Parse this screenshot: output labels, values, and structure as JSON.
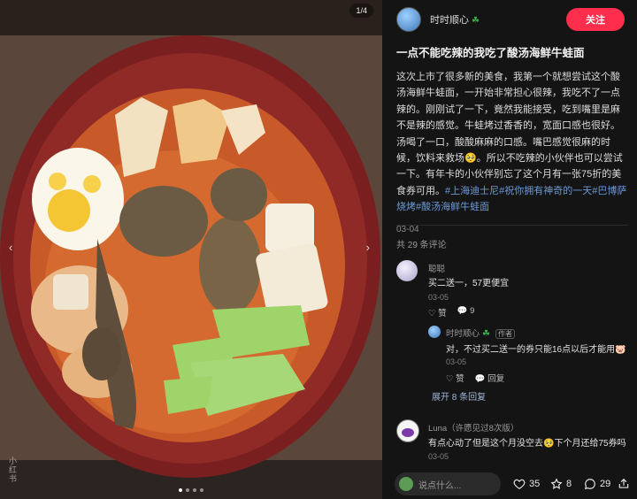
{
  "media": {
    "counter": "1/4",
    "watermark": "小红书",
    "nav_left": "‹",
    "nav_right": "›",
    "dots": [
      true,
      false,
      false,
      false
    ]
  },
  "author": {
    "name": "时时顺心",
    "badge": "☘",
    "follow_label": "关注"
  },
  "post": {
    "title": "一点不能吃辣的我吃了酸汤海鲜牛蛙面",
    "body": "这次上市了很多新的美食，我第一个就想尝试这个酸汤海鲜牛蛙面，一开始非常担心很辣，我吃不了一点辣的。刚刚试了一下，竟然我能接受，吃到嘴里是麻不是辣的感觉。牛蛙烤过香香的，宽面口感也很好。汤喝了一口，酸酸麻麻的口感。嘴巴感觉很麻的时候，饮料来救场🥺。所以不吃辣的小伙伴也可以尝试一下。有年卡的小伙伴别忘了这个月有一张75折的美食券可用。",
    "tags": [
      "#上海迪士尼",
      "#祝你拥有神奇的一天",
      "#巴博萨烧烤",
      "#酸汤海鲜牛蛙面"
    ],
    "date": "03-04"
  },
  "comments_header": "共 29 条评论",
  "comments": [
    {
      "name": "聪聪",
      "text": "买二送一，57更便宜",
      "date": "03-05",
      "like_label": "赞",
      "reply_count": "9"
    },
    {
      "name": "时时顺心",
      "badge": "☘",
      "author_tag": "作者",
      "text": "对，不过买二送一的券只能16点以后才能用🐷",
      "date": "03-05",
      "like_label": "赞",
      "reply_label": "回复",
      "expand_label": "展开 8 条回复"
    },
    {
      "name": "Luna（许愿见过8次版）",
      "text": "有点心动了但是这个月没空去🥺下个月还给75券吗",
      "date": "03-05"
    }
  ],
  "footer": {
    "input_placeholder": "说点什么...",
    "likes": "35",
    "collects": "8",
    "comments": "29"
  },
  "colors": {
    "accent": "#ff2e4d",
    "tag": "#6b9ad6",
    "background": "#141414"
  }
}
